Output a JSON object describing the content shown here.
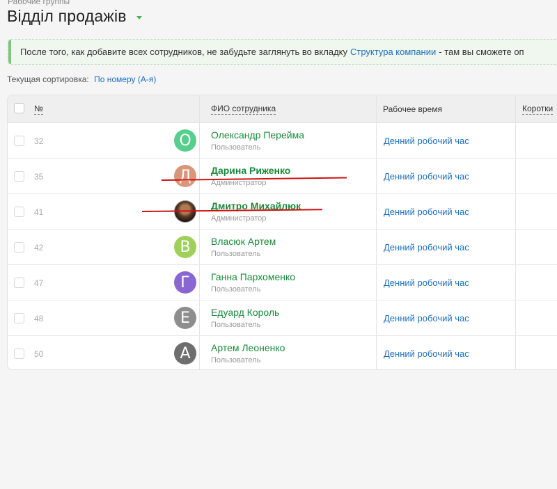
{
  "breadcrumb": "Рабочие группы",
  "page_title": "Відділ продажів",
  "notice": {
    "text_before": "После того, как добавите всех сотрудников, не забудьте заглянуть во вкладку",
    "link": "Структура компании",
    "text_after": "- там вы сможете оп"
  },
  "sort": {
    "label": "Текущая сортировка:",
    "value": "По номеру (А-я)"
  },
  "table": {
    "headers": {
      "num": "№",
      "name": "ФИО сотрудника",
      "hours": "Рабочее время",
      "short": "Коротки"
    },
    "rows": [
      {
        "num": "32",
        "avatar": "О",
        "avatar_color": "#55cf8b",
        "name": "Олександр Перейма",
        "role": "Пользователь",
        "hours": "Денний робочий час"
      },
      {
        "num": "35",
        "avatar": "Д",
        "avatar_color": "#d9977a",
        "name": "Дарина Риженко",
        "role": "Администратор",
        "hours": "Денний робочий час"
      },
      {
        "num": "41",
        "avatar": "",
        "avatar_color": "",
        "name": "Дмитро Михайлюк",
        "role": "Администратор",
        "hours": "Денний робочий час"
      },
      {
        "num": "42",
        "avatar": "В",
        "avatar_color": "#9fd05a",
        "name": "Власюк Артем",
        "role": "Пользователь",
        "hours": "Денний робочий час"
      },
      {
        "num": "47",
        "avatar": "Г",
        "avatar_color": "#8a66d3",
        "name": "Ганна Пархоменко",
        "role": "Пользователь",
        "hours": "Денний робочий час"
      },
      {
        "num": "48",
        "avatar": "Е",
        "avatar_color": "#8e8e8e",
        "name": "Едуард Король",
        "role": "Пользователь",
        "hours": "Денний робочий час"
      },
      {
        "num": "50",
        "avatar": "А",
        "avatar_color": "#6e6e6e",
        "name": "Артем Леоненко",
        "role": "Пользователь",
        "hours": "Денний робочий час"
      }
    ]
  },
  "colors": {
    "accent_green": "#4caf50",
    "name_green": "#1a8a3a",
    "link_blue": "#1e6fbf",
    "strike_red": "#d01010"
  }
}
